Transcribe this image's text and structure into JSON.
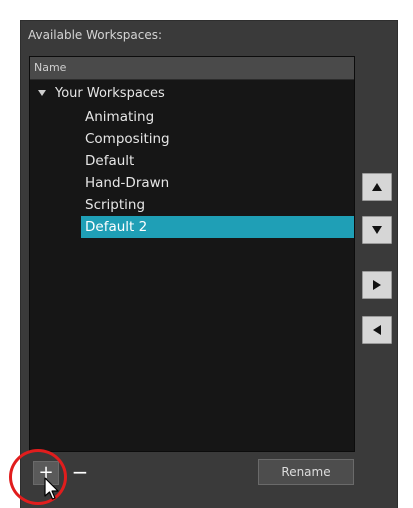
{
  "panel": {
    "title": "Available Workspaces:",
    "column_header": "Name"
  },
  "tree": {
    "root_label": "Your Workspaces",
    "items": [
      {
        "label": "Animating",
        "selected": false
      },
      {
        "label": "Compositing",
        "selected": false
      },
      {
        "label": "Default",
        "selected": false
      },
      {
        "label": "Hand-Drawn",
        "selected": false
      },
      {
        "label": "Scripting",
        "selected": false
      },
      {
        "label": "Default 2",
        "selected": true
      }
    ]
  },
  "side_buttons": [
    {
      "name": "move-up-button",
      "icon": "triangle-up-icon"
    },
    {
      "name": "move-down-button",
      "icon": "triangle-down-icon"
    },
    {
      "name": "add-to-toolbar-button",
      "icon": "triangle-right-icon"
    },
    {
      "name": "remove-from-toolbar-button",
      "icon": "triangle-left-icon"
    }
  ],
  "bottom": {
    "add_label": "+",
    "remove_label": "−",
    "rename_label": "Rename"
  },
  "colors": {
    "selection": "#1f9fb6",
    "dialog_bg": "#3a3a3a",
    "list_bg": "#161616",
    "highlight_ring": "#e11d1d"
  }
}
